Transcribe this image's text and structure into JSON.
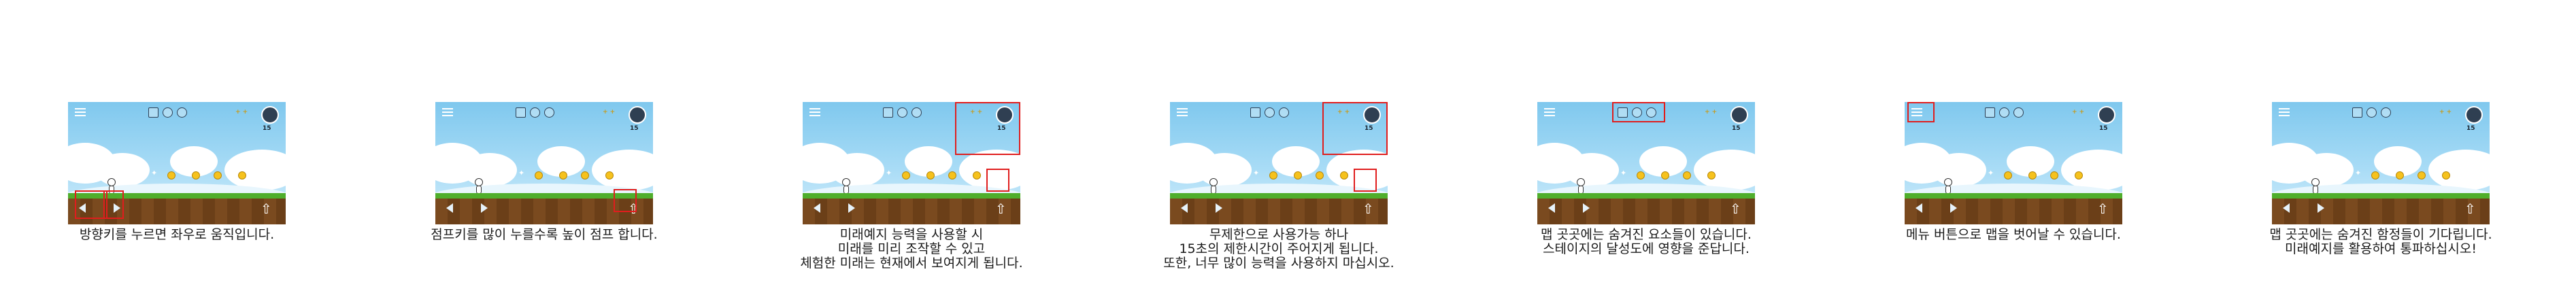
{
  "colors": {
    "sky": "#7fc8ee",
    "ground": "#7a4a1f",
    "grass": "#4fae2c",
    "highlight": "#e01d1d",
    "coin": "#f6c21d"
  },
  "icons": {
    "menu": "menu-icon",
    "timer": "timer-icon",
    "left": "left-arrow-icon",
    "right": "right-arrow-icon",
    "jump": "jump-arrow-icon",
    "slots": "ability-slot-icon",
    "coin": "coin-icon"
  },
  "hud": {
    "cost_text": "+ +",
    "timer_value": "15"
  },
  "panels": [
    {
      "caption": [
        "방향키를 누르면 좌우로 움직입니다."
      ]
    },
    {
      "caption": [
        "점프키를 많이 누를수록 높이 점프 합니다."
      ]
    },
    {
      "caption": [
        "미래예지 능력을 사용할 시",
        "미래를 미리 조작할 수 있고",
        "체험한 미래는 현재에서 보여지게 됩니다."
      ]
    },
    {
      "caption": [
        "무제한으로 사용가능 하나",
        "15초의 제한시간이 주어지게 됩니다.",
        "또한, 너무 많이 능력을 사용하지 마십시오."
      ]
    },
    {
      "caption": [
        "맵 곳곳에는 숨겨진 요소들이 있습니다.",
        "스테이지의 달성도에 영향을 준답니다."
      ]
    },
    {
      "caption": [
        "메뉴 버튼으로 맵을 벗어날 수 있습니다."
      ]
    },
    {
      "caption": [
        "맵 곳곳에는 숨겨진 함정들이 기다립니다.",
        "미래예지를 활용하여 통파하십시오!"
      ]
    }
  ]
}
